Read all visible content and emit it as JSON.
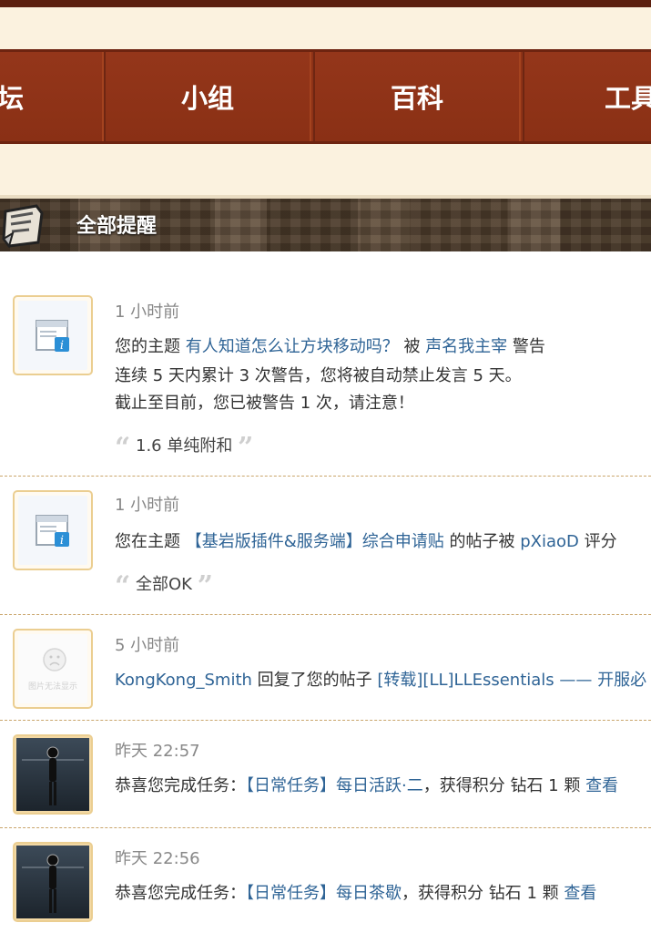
{
  "nav": {
    "items": [
      {
        "label": "坛"
      },
      {
        "label": "小组"
      },
      {
        "label": "百科"
      },
      {
        "label": "工具"
      }
    ]
  },
  "section": {
    "title": "全部提醒"
  },
  "notices": [
    {
      "time": "1 小时前",
      "line1": {
        "prefix": "您的主题 ",
        "topic": "有人知道怎么让方块移动吗？",
        "mid": " 被 ",
        "user": "声名我主宰",
        "suffix": " 警告"
      },
      "line2": "连续 5 天内累计 3 次警告，您将被自动禁止发言 5 天。",
      "line3": "截止至目前，您已被警告 1 次，请注意！",
      "quote": "1.6 单纯附和"
    },
    {
      "time": "1 小时前",
      "line1": {
        "prefix": "您在主题 ",
        "topic": "【基岩版插件&服务端】综合申请贴",
        "mid": " 的帖子被 ",
        "user": "pXiaoD",
        "suffix": " 评分"
      },
      "quote": "全部OK"
    },
    {
      "time": "5 小时前",
      "avatar_text": "图片无法显示",
      "line1": {
        "user": "KongKong_Smith",
        "mid": " 回复了您的帖子 ",
        "topic": "[转载][LL]LLEssentials —— 开服必"
      }
    },
    {
      "time": "昨天 22:57",
      "line1": {
        "prefix": "恭喜您完成任务：",
        "task": "【日常任务】每日活跃·二",
        "suffix": "，获得积分 钻石 1 颗  ",
        "view": "查看"
      }
    },
    {
      "time": "昨天 22:56",
      "line1": {
        "prefix": "恭喜您完成任务：",
        "task": "【日常任务】每日茶歇",
        "suffix": "，获得积分 钻石 1 颗  ",
        "view": "查看"
      }
    }
  ],
  "colors": {
    "nav_bg": "#8e3216",
    "cream": "#fbf2df",
    "link": "#2f6496",
    "divider": "#c9a56b"
  }
}
